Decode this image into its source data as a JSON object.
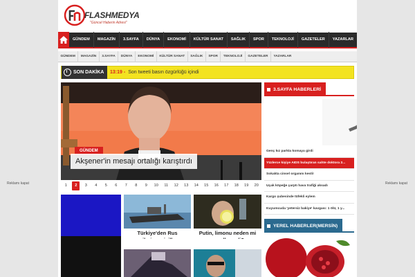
{
  "side_ads": {
    "left": "Reklamı kapat",
    "right": "Reklamı kapat"
  },
  "logo": {
    "name": "FLASHMEDYA",
    "tagline": "\"Güncel Haberin Adresi\""
  },
  "main_nav": [
    "GÜNDEM",
    "MAGAZİN",
    "3.SAYFA",
    "DÜNYA",
    "EKONOMİ",
    "KÜLTÜR SANAT",
    "SAĞLIK",
    "SPOR",
    "TEKNOLOJİ",
    "GAZETELER",
    "YAZARLAR"
  ],
  "sub_nav": [
    "GÜNDEM",
    "MAGAZİN",
    "3.SAYFA",
    "DÜNYA",
    "EKONOMİ",
    "KÜLTÜR SANAT",
    "SAĞLIK",
    "SPOR",
    "TEKNOLOJİ",
    "GAZETELER",
    "YAZARLAR"
  ],
  "ticker": {
    "label": "SON DAKİKA",
    "time": "13:19 -",
    "text": "Son tweeti basın özgürlüğü içindi"
  },
  "slider": {
    "category": "GÜNDEM",
    "title": "Akşener'in mesajı ortalığı karıştırdı",
    "pages": [
      "1",
      "2",
      "3",
      "4",
      "5",
      "6",
      "7",
      "8",
      "9",
      "10",
      "11",
      "12",
      "13",
      "14",
      "15",
      "16",
      "17",
      "18",
      "19",
      "20"
    ],
    "active_page": 2
  },
  "grid": [
    {
      "title": ""
    },
    {
      "title": "Türkiye'den Rus gemilerine misilleme"
    },
    {
      "title": "Putin, limonu neden mi engellemedi?"
    },
    {
      "title": ""
    },
    {
      "title": ""
    }
  ],
  "section_3sayfa": {
    "title": "3.SAYFA HABERLERİ",
    "items": [
      "Genç kız parkta komaya girdi",
      "Yüzlerce kişiye AIDS bulaştıran sahte doktora 2...",
      "Sokakta cinsel organını kesti!",
      "Uçak köpeğe çarptı hava trafiği aksadı",
      "Kargo şubesinde tüfekli eylem",
      "Kuyumcuda 'yetersiz bakiye' kavgası: 1 ölü, 1 y..."
    ],
    "active_index": 1
  },
  "section_yerel": {
    "title": "YEREL HABERLER(MERSİN)"
  },
  "colors": {
    "brand_red": "#d8201f",
    "nav_dark": "#2a2a2a",
    "ticker_yellow": "#f3e320",
    "local_blue": "#2b6a8f"
  }
}
